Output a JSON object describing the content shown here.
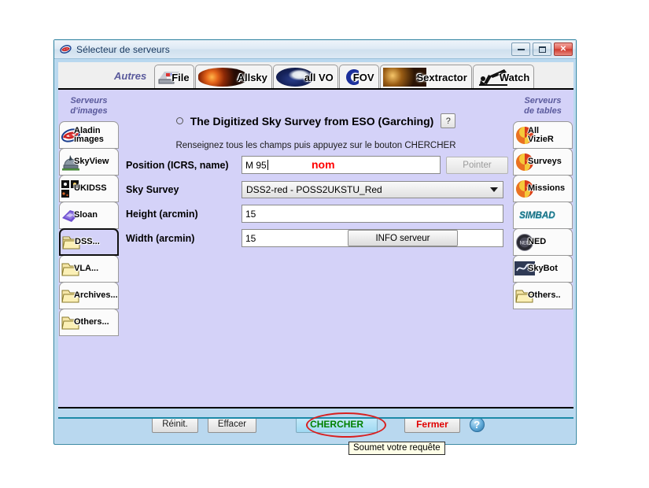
{
  "window": {
    "title": "Sélecteur de serveurs",
    "logo_icon": "aladin-spiral-icon",
    "minimize_label": "minimize-icon",
    "maximize_label": "maximize-icon",
    "close_label": "✕"
  },
  "tabs": {
    "group_label": "Autres",
    "items": [
      {
        "label": "File",
        "icon": "floppy-disk-icon"
      },
      {
        "label": "Allsky",
        "icon": "allsky-nebula-icon"
      },
      {
        "label": "all VO",
        "icon": "virtual-observatory-icon"
      },
      {
        "label": "FOV",
        "icon": "field-of-view-icon"
      },
      {
        "label": "Sextractor",
        "icon": "sextractor-stars-icon"
      },
      {
        "label": "Watch",
        "icon": "telescope-icon"
      }
    ]
  },
  "left_sidebar": {
    "heading_line1": "Serveurs",
    "heading_line2": "d'images",
    "items": [
      {
        "label": "Aladin images",
        "icon": "aladin-spiral-icon",
        "selected": false
      },
      {
        "label": "SkyView",
        "icon": "observatory-dome-icon",
        "selected": false
      },
      {
        "label": "UKIDSS",
        "icon": "ukidss-tiles-icon",
        "selected": false
      },
      {
        "label": "Sloan",
        "icon": "sloan-telescope-icon",
        "selected": false
      },
      {
        "label": "DSS...",
        "icon": "folder-icon",
        "selected": true
      },
      {
        "label": "VLA...",
        "icon": "folder-icon",
        "selected": false
      },
      {
        "label": "Archives...",
        "icon": "folder-icon",
        "selected": false
      },
      {
        "label": "Others...",
        "icon": "folder-icon",
        "selected": false
      }
    ]
  },
  "right_sidebar": {
    "heading_line1": "Serveurs",
    "heading_line2": "de tables",
    "items": [
      {
        "label": "All VizieR",
        "icon": "vizier-spiral-icon",
        "selected": false
      },
      {
        "label": "Surveys",
        "icon": "vizier-spiral-icon",
        "selected": false
      },
      {
        "label": "Missions",
        "icon": "vizier-spiral-icon",
        "selected": false
      },
      {
        "label": "SIMBAD",
        "icon": "simbad-icon",
        "selected": false
      },
      {
        "label": "NED",
        "icon": "ned-globe-icon",
        "selected": false
      },
      {
        "label": "SkyBot",
        "icon": "skybot-icon",
        "selected": false
      },
      {
        "label": "Others..",
        "icon": "folder-icon",
        "selected": false
      }
    ]
  },
  "form": {
    "server_radio_selected": false,
    "server_title": "The Digitized Sky Survey from ESO (Garching)",
    "help_button_label": "?",
    "instruction": "Renseignez tous les champs puis appuyez sur le bouton CHERCHER",
    "position_label": "Position (ICRS, name)",
    "position_value": "M 95",
    "position_annotation": "nom",
    "annotation_color": "#ff0000",
    "pointer_button": "Pointer",
    "pointer_enabled": false,
    "survey_label": "Sky Survey",
    "survey_value": "DSS2-red - POSS2UKSTU_Red",
    "height_label": "Height (arcmin)",
    "height_value": "15",
    "width_label": "Width (arcmin)",
    "width_value": "15",
    "info_button": "INFO serveur"
  },
  "buttons": {
    "reinit": "Réinit.",
    "effacer": "Effacer",
    "chercher": "CHERCHER",
    "chercher_text_color": "#008000",
    "fermer": "Fermer",
    "fermer_text_color": "#e00000",
    "help_icon_label": "?"
  },
  "annotation": {
    "highlight_shape": "red-ellipse",
    "highlight_color": "#d81f1f"
  },
  "tooltip": {
    "text": "Soumet votre requête"
  }
}
